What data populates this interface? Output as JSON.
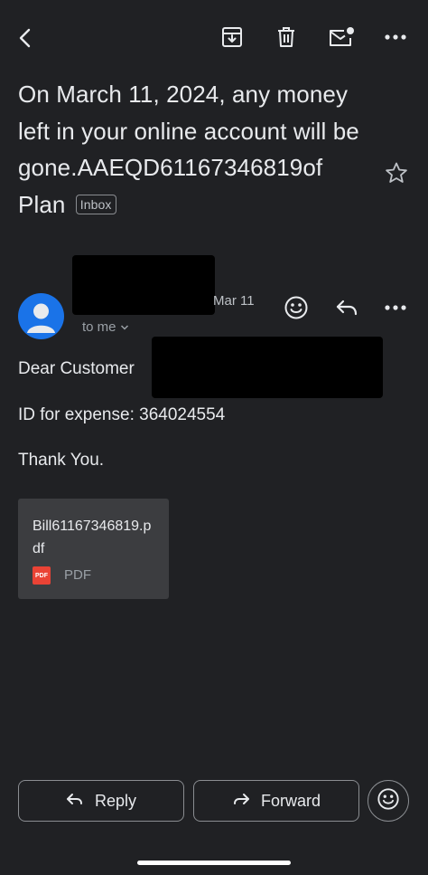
{
  "toolbar": {
    "back_icon": "arrow-back-icon",
    "archive_icon": "archive-icon",
    "delete_icon": "trash-icon",
    "mark_unread_icon": "mark-unread-icon",
    "more_icon": "more-horizontal-icon"
  },
  "email": {
    "subject": "On March 11, 2024, any money left in your online account will be gone.AAEQD61167346819of Plan",
    "label": "Inbox",
    "date": "Mar 11",
    "recipient": "to me",
    "body": {
      "greeting": "Dear Customer",
      "expense_line": "ID for expense: 364024554",
      "closing": "Thank You."
    },
    "attachment": {
      "filename": "Bill61167346819.pdf",
      "type_badge": "PDF",
      "type_label": "PDF"
    }
  },
  "actions": {
    "reply_label": "Reply",
    "forward_label": "Forward"
  },
  "colors": {
    "background": "#202124",
    "avatar": "#1a73e8",
    "attachment_card": "#3c3d40",
    "pdf_badge": "#ea4335"
  }
}
